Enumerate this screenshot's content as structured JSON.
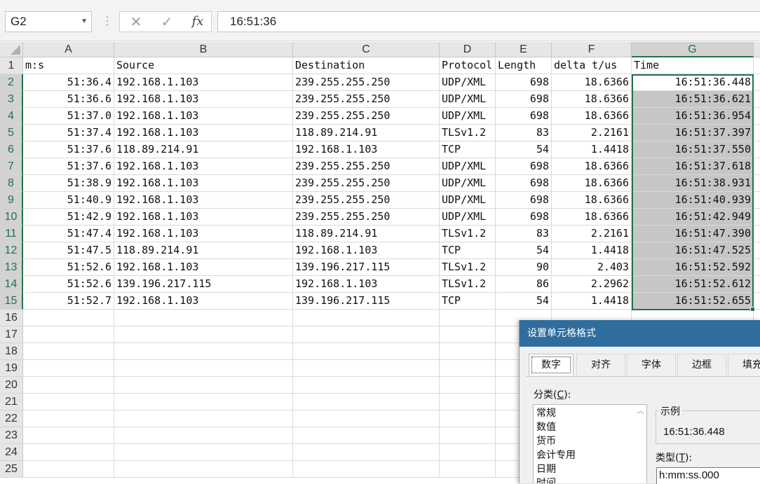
{
  "formula_bar": {
    "name_box": "G2",
    "formula_value": "16:51:36",
    "icons": {
      "cancel": "x-icon",
      "enter": "check-icon",
      "function": "fx-icon"
    }
  },
  "sheet": {
    "columns": [
      "A",
      "B",
      "C",
      "D",
      "E",
      "F",
      "G"
    ],
    "selected_column": "G",
    "row_count": 25,
    "header_row": [
      "m:s",
      "Source",
      "Destination",
      "Protocol",
      "Length",
      "delta t/us",
      "Time"
    ],
    "rows": [
      [
        "51:36.4",
        "192.168.1.103",
        "239.255.255.250",
        "UDP/XML",
        "698",
        "18.6366",
        "16:51:36.448"
      ],
      [
        "51:36.6",
        "192.168.1.103",
        "239.255.255.250",
        "UDP/XML",
        "698",
        "18.6366",
        "16:51:36.621"
      ],
      [
        "51:37.0",
        "192.168.1.103",
        "239.255.255.250",
        "UDP/XML",
        "698",
        "18.6366",
        "16:51:36.954"
      ],
      [
        "51:37.4",
        "192.168.1.103",
        "118.89.214.91",
        "TLSv1.2",
        "83",
        "2.2161",
        "16:51:37.397"
      ],
      [
        "51:37.6",
        "118.89.214.91",
        "192.168.1.103",
        "TCP",
        "54",
        "1.4418",
        "16:51:37.550"
      ],
      [
        "51:37.6",
        "192.168.1.103",
        "239.255.255.250",
        "UDP/XML",
        "698",
        "18.6366",
        "16:51:37.618"
      ],
      [
        "51:38.9",
        "192.168.1.103",
        "239.255.255.250",
        "UDP/XML",
        "698",
        "18.6366",
        "16:51:38.931"
      ],
      [
        "51:40.9",
        "192.168.1.103",
        "239.255.255.250",
        "UDP/XML",
        "698",
        "18.6366",
        "16:51:40.939"
      ],
      [
        "51:42.9",
        "192.168.1.103",
        "239.255.255.250",
        "UDP/XML",
        "698",
        "18.6366",
        "16:51:42.949"
      ],
      [
        "51:47.4",
        "192.168.1.103",
        "118.89.214.91",
        "TLSv1.2",
        "83",
        "2.2161",
        "16:51:47.390"
      ],
      [
        "51:47.5",
        "118.89.214.91",
        "192.168.1.103",
        "TCP",
        "54",
        "1.4418",
        "16:51:47.525"
      ],
      [
        "51:52.6",
        "192.168.1.103",
        "139.196.217.115",
        "TLSv1.2",
        "90",
        "2.403",
        "16:51:52.592"
      ],
      [
        "51:52.6",
        "139.196.217.115",
        "192.168.1.103",
        "TLSv1.2",
        "86",
        "2.2962",
        "16:51:52.612"
      ],
      [
        "51:52.7",
        "192.168.1.103",
        "139.196.217.115",
        "TCP",
        "54",
        "1.4418",
        "16:51:52.655"
      ]
    ]
  },
  "dialog": {
    "title": "设置单元格格式",
    "tabs": [
      "数字",
      "对齐",
      "字体",
      "边框",
      "填充"
    ],
    "active_tab": "数字",
    "category_label": "分类(",
    "category_key": "C",
    "category_label_end": "):",
    "categories": [
      "常规",
      "数值",
      "货币",
      "会计专用",
      "日期",
      "时间"
    ],
    "sample_label": "示例",
    "sample_value": "16:51:36.448",
    "type_label": "类型(",
    "type_key": "T",
    "type_label_end": "):",
    "type_value": "h:mm:ss.000"
  },
  "colors": {
    "accent": "#217346",
    "selection_fill": "#c6c6c6",
    "dialog_title": "#2e6d9e"
  }
}
